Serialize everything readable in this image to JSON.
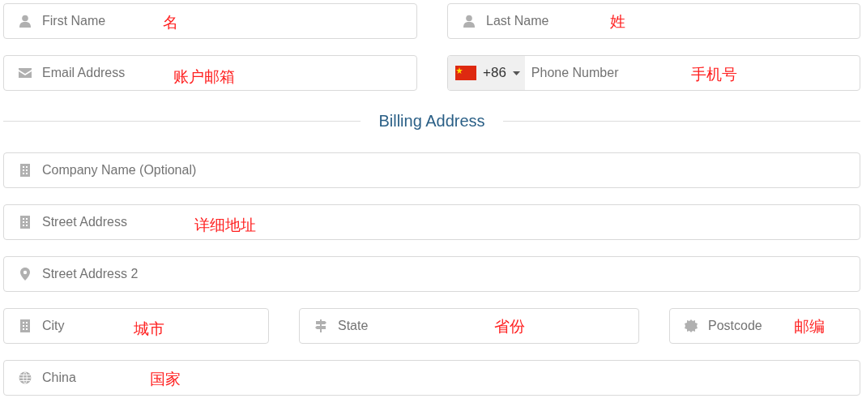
{
  "account_rows": [
    {
      "fields": [
        {
          "kind": "text",
          "placeholder": "First Name",
          "annotation": "名"
        },
        {
          "kind": "text",
          "placeholder": "Last Name",
          "annotation": "姓"
        }
      ]
    },
    {
      "fields": [
        {
          "kind": "text",
          "placeholder": "Email Address",
          "annotation": "账户邮箱"
        },
        {
          "kind": "phone",
          "dial_code": "+86",
          "placeholder": "Phone Number",
          "annotation": "手机号"
        }
      ]
    }
  ],
  "section_title": "Billing Address",
  "address_rows": [
    {
      "fields": [
        {
          "kind": "text",
          "placeholder": "Company Name (Optional)"
        }
      ]
    },
    {
      "fields": [
        {
          "kind": "text",
          "placeholder": "Street Address",
          "annotation": "详细地址"
        }
      ]
    },
    {
      "fields": [
        {
          "kind": "text",
          "placeholder": "Street Address 2"
        }
      ]
    },
    {
      "fields": [
        {
          "kind": "text",
          "placeholder": "City",
          "annotation": "城市"
        },
        {
          "kind": "text",
          "placeholder": "State",
          "annotation": "省份"
        },
        {
          "kind": "text",
          "placeholder": "Postcode",
          "annotation": "邮编"
        }
      ]
    },
    {
      "fields": [
        {
          "kind": "select",
          "value": "China",
          "annotation": "国家"
        }
      ]
    }
  ]
}
